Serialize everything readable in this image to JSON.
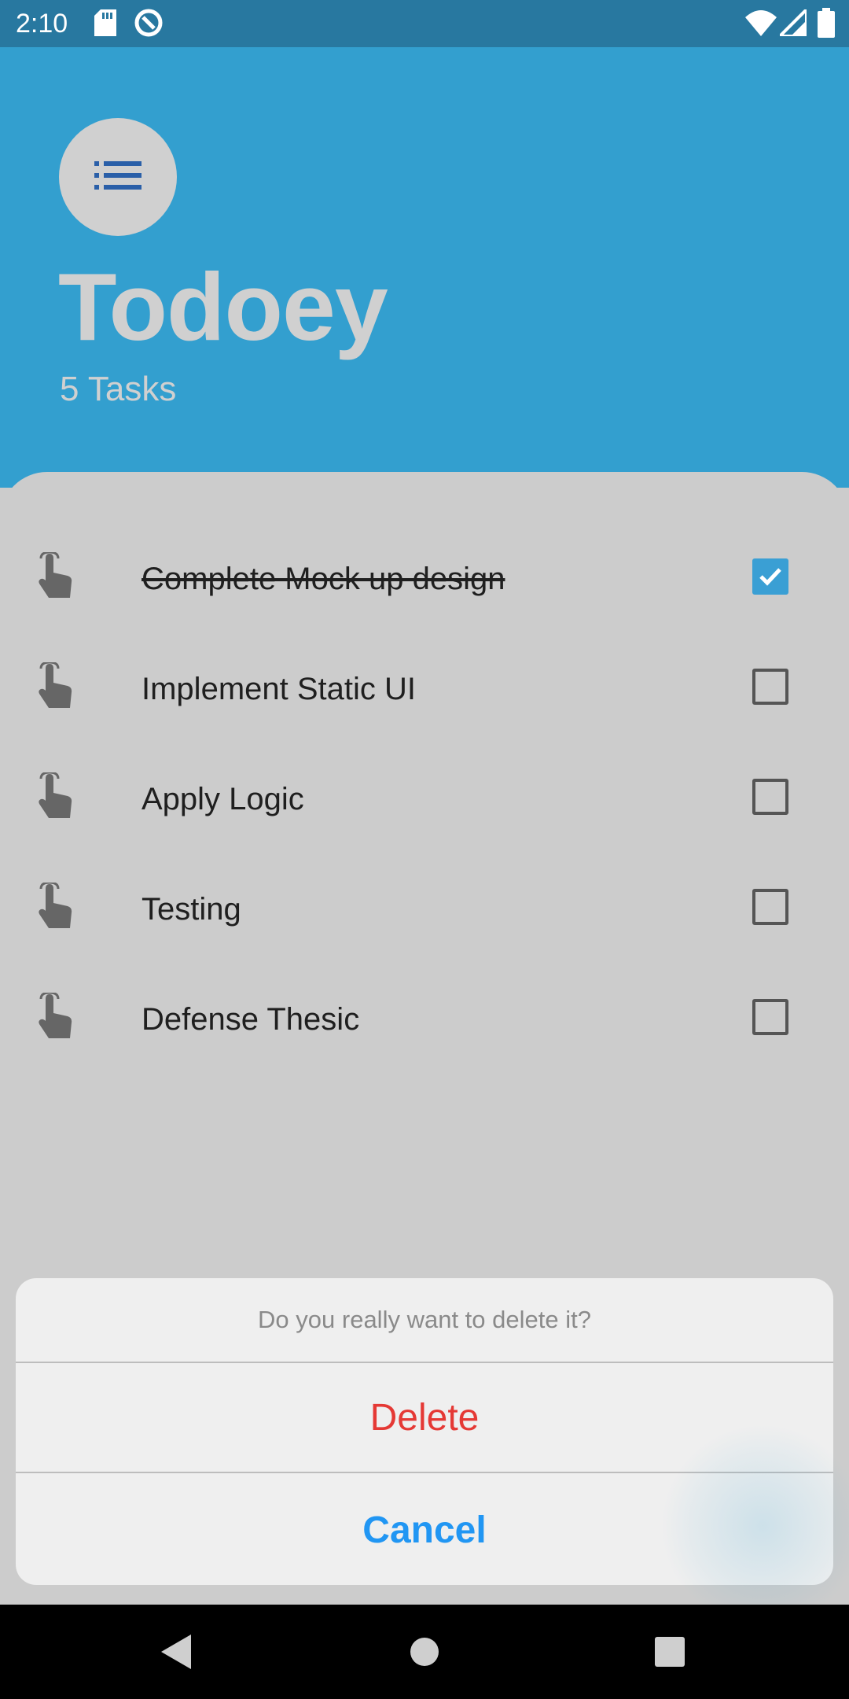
{
  "status_bar": {
    "time": "2:10",
    "left_icons": [
      "sd-card-icon",
      "data-saver-icon"
    ],
    "right_icons": [
      "wifi-icon",
      "cell-signal-icon",
      "battery-icon"
    ]
  },
  "header": {
    "logo_icon": "list-icon",
    "title": "Todoey",
    "task_count": "5 Tasks"
  },
  "tasks": [
    {
      "label": "Complete Mock up design",
      "done": true
    },
    {
      "label": "Implement Static UI",
      "done": false
    },
    {
      "label": "Apply Logic",
      "done": false
    },
    {
      "label": "Testing",
      "done": false
    },
    {
      "label": "Defense Thesic",
      "done": false
    }
  ],
  "action_sheet": {
    "message": "Do you really want to delete it?",
    "delete_label": "Delete",
    "cancel_label": "Cancel"
  },
  "colors": {
    "header_bg": "#339fcf",
    "status_bar_bg": "#2878a0",
    "delete": "#e53935",
    "cancel": "#2196f3",
    "check": "#3a9fd4"
  },
  "nav_bar": [
    "back-icon",
    "home-icon",
    "recents-icon"
  ]
}
